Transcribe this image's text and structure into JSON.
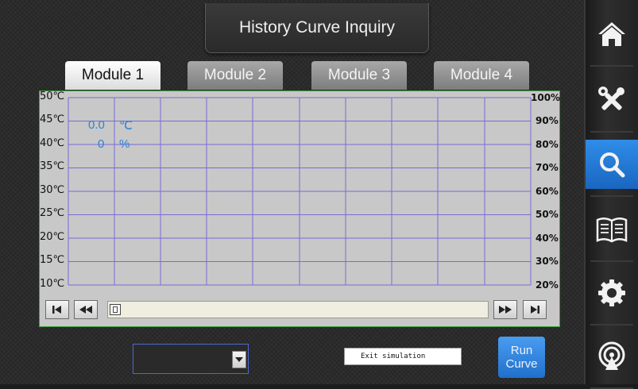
{
  "header": {
    "title": "History Curve Inquiry"
  },
  "tabs": [
    {
      "label": "Module 1",
      "active": true
    },
    {
      "label": "Module 2",
      "active": false
    },
    {
      "label": "Module 3",
      "active": false
    },
    {
      "label": "Module 4",
      "active": false
    }
  ],
  "chart": {
    "left_axis": [
      "50℃",
      "45℃",
      "40℃",
      "35℃",
      "30℃",
      "25℃",
      "20℃",
      "15℃",
      "10℃"
    ],
    "right_axis": [
      "100%",
      "90%",
      "80%",
      "70%",
      "60%",
      "50%",
      "40%",
      "30%",
      "20%"
    ],
    "readout": {
      "temp_value": "0.0",
      "temp_unit": "℃",
      "humidity_value": "0",
      "humidity_unit": "%"
    }
  },
  "controls": {
    "simulation_label": "Exit simulation",
    "run_line1": "Run",
    "run_line2": "Curve"
  },
  "sidebar": [
    {
      "icon": "home-icon",
      "active": false
    },
    {
      "icon": "tools-icon",
      "active": false
    },
    {
      "icon": "search-icon",
      "active": true
    },
    {
      "icon": "book-icon",
      "active": false
    },
    {
      "icon": "gear-icon",
      "active": false
    },
    {
      "icon": "signal-icon",
      "active": false
    }
  ],
  "colors": {
    "accent": "#2f8de8",
    "readout": "#2f7fd6",
    "grid": "#7a6ad6",
    "frame": "#3aa03a"
  }
}
